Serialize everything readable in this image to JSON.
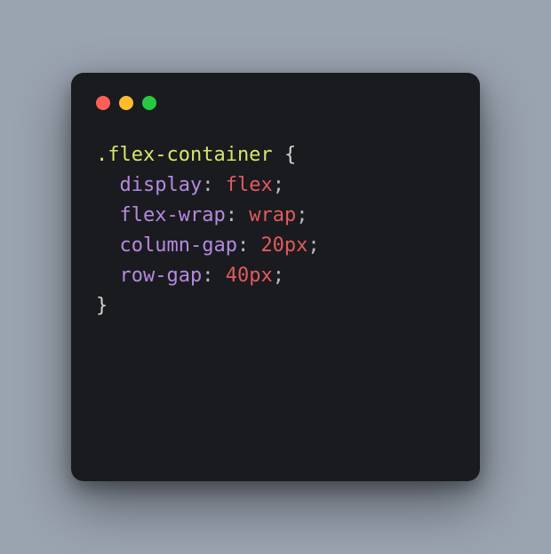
{
  "code": {
    "selector": ".flex-container",
    "open_brace": "{",
    "close_brace": "}",
    "declarations": [
      {
        "prop": "display",
        "value": "flex"
      },
      {
        "prop": "flex-wrap",
        "value": "wrap"
      },
      {
        "prop": "column-gap",
        "value": "20px"
      },
      {
        "prop": "row-gap",
        "value": "40px"
      }
    ],
    "colon": ":",
    "semicolon": ";",
    "space": " "
  }
}
